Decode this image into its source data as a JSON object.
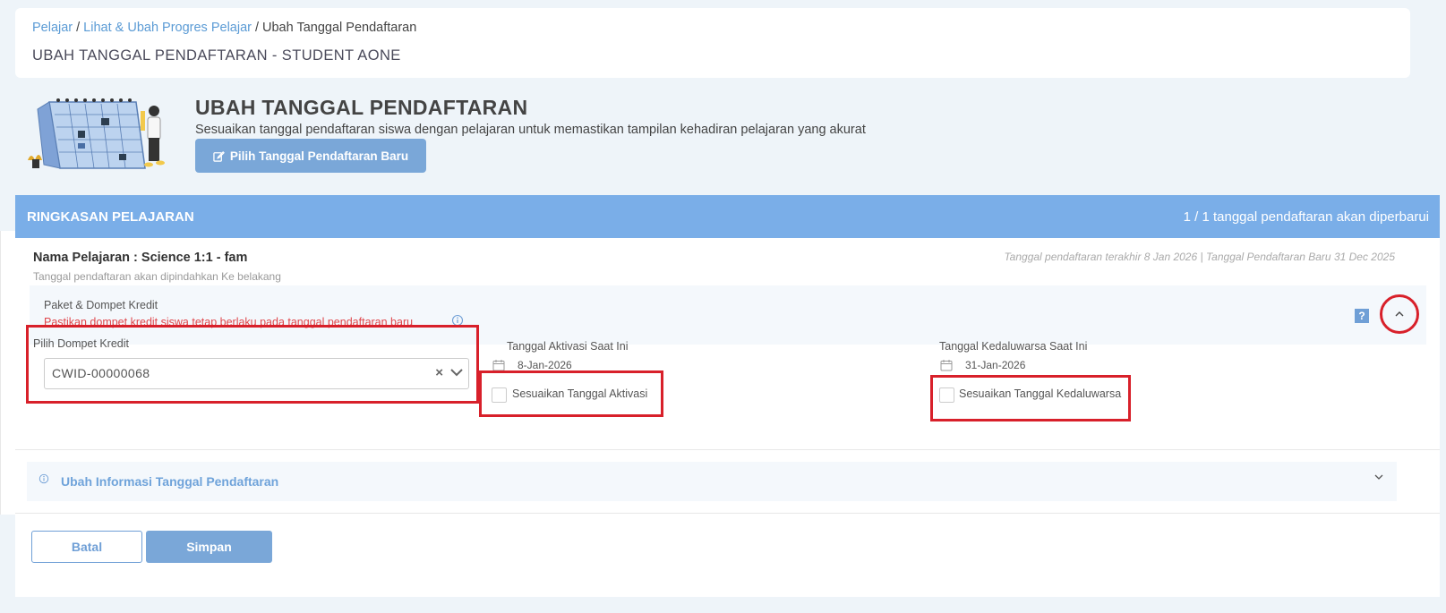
{
  "breadcrumb": {
    "items": [
      "Pelajar",
      "Lihat & Ubah Progres Pelajar",
      "Ubah Tanggal Pendaftaran"
    ],
    "separator": "/"
  },
  "page_title": "UBAH TANGGAL PENDAFTARAN - STUDENT AONE",
  "hero": {
    "title": "UBAH TANGGAL PENDAFTARAN",
    "subtitle": "Sesuaikan tanggal pendaftaran siswa dengan pelajaran untuk memastikan tampilan kehadiran pelajaran yang akurat",
    "button_label": "Pilih Tanggal Pendaftaran Baru",
    "button_icon": "edit-icon"
  },
  "summary": {
    "header_left": "RINGKASAN PELAJARAN",
    "header_right": "1 / 1 tanggal pendaftaran akan diperbarui"
  },
  "lesson": {
    "name": "Nama Pelajaran : Science 1:1 - fam",
    "note": "Tanggal pendaftaran akan dipindahkan Ke belakang",
    "dates": "Tanggal pendaftaran terakhir 8 Jan 2026 | Tanggal Pendaftaran Baru 31 Dec 2025"
  },
  "package": {
    "title": "Paket & Dompet Kredit",
    "warning": "Pastikan dompet kredit siswa tetap berlaku pada tanggal pendaftaran baru",
    "help_label": "?"
  },
  "wallet": {
    "label": "Pilih Dompet Kredit",
    "value": "CWID-00000068",
    "clear_label": "×"
  },
  "activation": {
    "label": "Tanggal Aktivasi Saat Ini",
    "date": "8-Jan-2026",
    "checkbox_label": "Sesuaikan Tanggal Aktivasi"
  },
  "expiry": {
    "label": "Tanggal Kedaluwarsa Saat Ini",
    "date": "31-Jan-2026",
    "checkbox_label": "Sesuaikan Tanggal Kedaluwarsa"
  },
  "info_accordion": {
    "label": "Ubah Informasi Tanggal Pendaftaran"
  },
  "buttons": {
    "cancel": "Batal",
    "save": "Simpan"
  },
  "colors": {
    "accent": "#7aa7d8",
    "header_blue": "#7aaee8",
    "link": "#5b9bd5",
    "warning": "#e0474c",
    "highlight": "#d8202a"
  }
}
